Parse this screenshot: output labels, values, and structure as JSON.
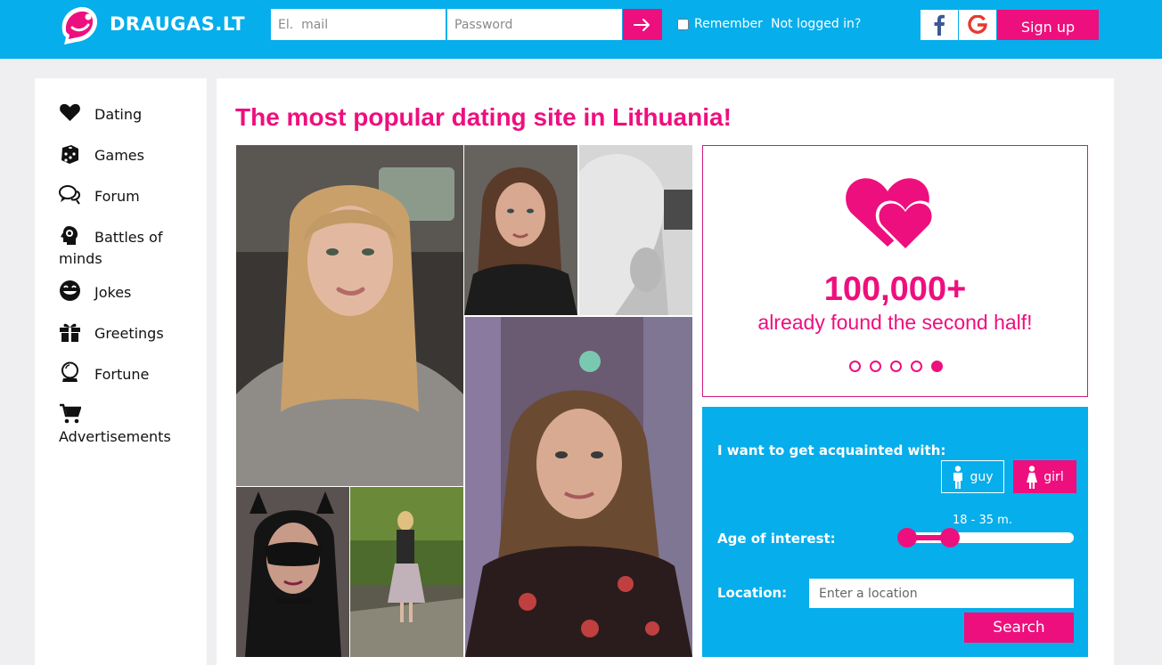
{
  "header": {
    "logo_text": "DRAUGAS.LT",
    "email_placeholder": "El.  mail",
    "password_placeholder": "Password",
    "remember_label": "Remember",
    "not_logged_in": "Not logged in?",
    "facebook_icon": "facebook-icon",
    "google_icon": "google-icon",
    "signup_label": "Sign up",
    "colors": {
      "brand_blue": "#06aeeb",
      "accent_pink": "#ee0f7e"
    }
  },
  "sidebar": {
    "items": [
      {
        "label": "Dating",
        "icon": "heart-icon"
      },
      {
        "label": "Games",
        "icon": "dice-icon"
      },
      {
        "label": "Forum",
        "icon": "chat-icon"
      },
      {
        "label": "Battles of minds",
        "icon": "brain-head-icon"
      },
      {
        "label": "Jokes",
        "icon": "smile-icon"
      },
      {
        "label": "Greetings",
        "icon": "gift-icon"
      },
      {
        "label": "Fortune",
        "icon": "crystal-ball-icon"
      },
      {
        "label": "Advertisements",
        "icon": "cart-icon"
      }
    ]
  },
  "main": {
    "headline": "The most popular dating site in Lithuania!",
    "promo": {
      "count": "100,000+",
      "text": "already found the second half!",
      "slides": 5,
      "active_slide": 5
    },
    "search": {
      "acquaint_label": "I want to get acquainted with:",
      "guy_label": "guy",
      "girl_label": "girl",
      "selected_gender": "girl",
      "age_label": "Age of interest:",
      "age_value": "18 - 35 m.",
      "age_min": 18,
      "age_max": 35,
      "location_label": "Location:",
      "location_placeholder": "Enter a location",
      "search_button": "Search"
    }
  }
}
